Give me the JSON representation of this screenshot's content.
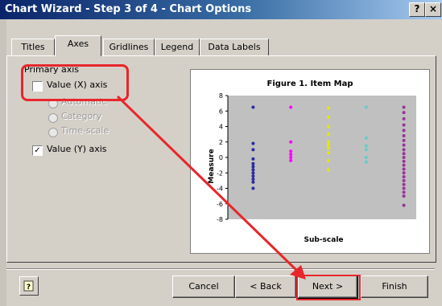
{
  "window": {
    "title": "Chart Wizard - Step 3 of 4 - Chart Options",
    "help_glyph": "?",
    "close_glyph": "×"
  },
  "tabs": [
    "Titles",
    "Axes",
    "Gridlines",
    "Legend",
    "Data Labels"
  ],
  "active_tab": "Axes",
  "axes": {
    "group_label": "Primary axis",
    "x_axis_label": "Value (X) axis",
    "x_axis_checked": false,
    "radio_options": [
      "Automatic",
      "Category",
      "Time-scale"
    ],
    "y_axis_label": "Value (Y) axis",
    "y_axis_checked": true,
    "check_glyph": "✓"
  },
  "chart_data": {
    "type": "scatter",
    "title": "Figure 1. Item Map",
    "xlabel": "Sub-scale",
    "ylabel": "Measure",
    "ylim": [
      -8,
      8
    ],
    "yticks": [
      8,
      6,
      4,
      2,
      0,
      -2,
      -4,
      -6,
      -8
    ],
    "plot_bg": "#c0c0c0",
    "series": [
      {
        "color": "#2a2aa0",
        "x": 1,
        "values": [
          6.5,
          1.8,
          1.0,
          -0.2,
          -0.8,
          -1.2,
          -1.6,
          -2.0,
          -2.4,
          -2.8,
          -3.2,
          -4.0
        ]
      },
      {
        "color": "#ff00ff",
        "x": 2,
        "values": [
          6.5,
          2.0,
          0.8,
          0.4,
          0.0,
          -0.4
        ]
      },
      {
        "color": "#e6e600",
        "x": 3,
        "values": [
          6.4,
          5.2,
          4.0,
          3.0,
          2.0,
          1.6,
          1.2,
          0.6,
          -0.4,
          -1.6
        ]
      },
      {
        "color": "#66cccc",
        "x": 4,
        "values": [
          6.5,
          2.5,
          1.5,
          1.0,
          0.0,
          -0.6
        ]
      },
      {
        "color": "#993399",
        "x": 5,
        "values": [
          6.5,
          5.8,
          5.0,
          4.2,
          3.5,
          2.8,
          2.2,
          1.6,
          1.0,
          0.5,
          0.0,
          -0.5,
          -1.0,
          -1.5,
          -2.0,
          -2.5,
          -3.0,
          -3.5,
          -4.0,
          -4.5,
          -5.0,
          -6.2
        ]
      }
    ]
  },
  "buttons": {
    "cancel": "Cancel",
    "back": "< Back",
    "next": "Next >",
    "finish": "Finish"
  },
  "annotation_color": "#e8262b"
}
